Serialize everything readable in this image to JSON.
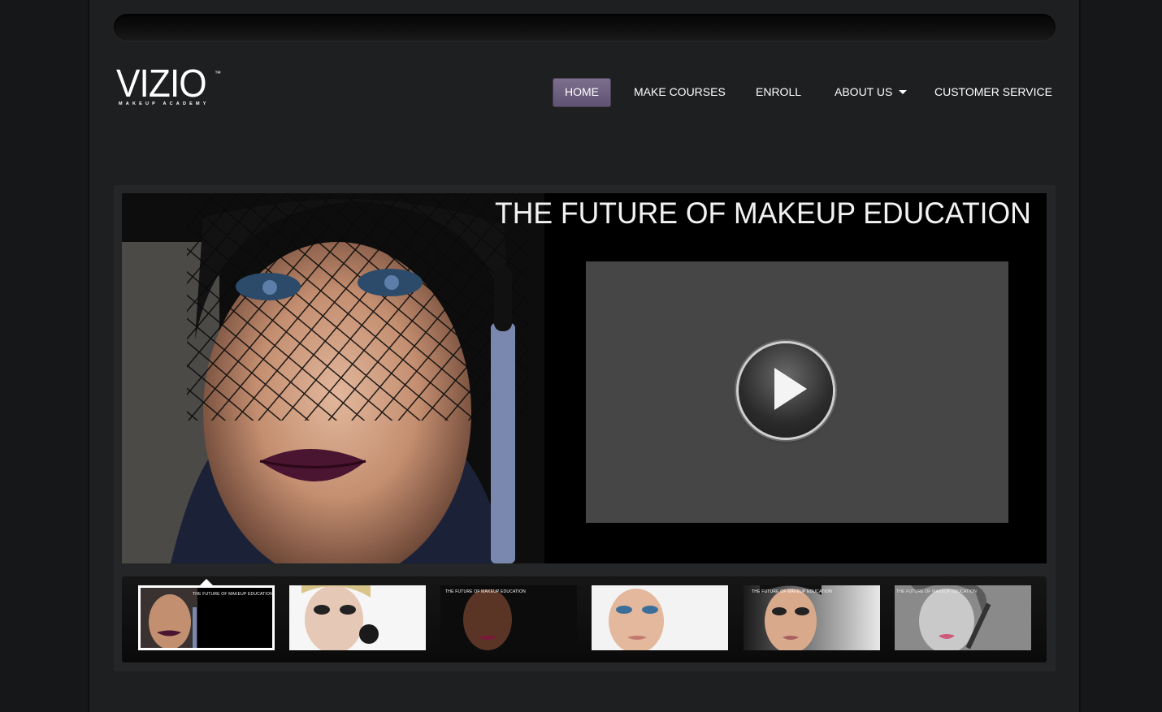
{
  "brand": {
    "name": "VIZIO",
    "tagline": "MAKEUP ACADEMY",
    "tm": "™"
  },
  "nav": {
    "items": [
      {
        "label": "HOME",
        "active": true
      },
      {
        "label": "MAKE COURSES",
        "active": false
      },
      {
        "label": "ENROLL",
        "active": false
      },
      {
        "label": "ABOUT US",
        "active": false,
        "has_dropdown": true
      },
      {
        "label": "CUSTOMER SERVICE",
        "active": false
      }
    ]
  },
  "hero": {
    "title": "THE FUTURE OF MAKEUP EDUCATION",
    "video": {
      "icon": "play-icon"
    }
  },
  "thumbnails": [
    {
      "caption": "THE FUTURE OF MAKEUP EDUCATION",
      "active": true
    },
    {
      "caption": "",
      "active": false
    },
    {
      "caption": "THE FUTURE OF MAKEUP EDUCATION",
      "active": false
    },
    {
      "caption": "",
      "active": false
    },
    {
      "caption": "THE FUTURE OF MAKEUP EDUCATION",
      "active": false
    },
    {
      "caption": "THE FUTURE OF MAKEUP EDUCATION",
      "active": false
    }
  ],
  "colors": {
    "nav_active": "#6f6180",
    "page_bg": "#1e1f20",
    "video_bg": "#464646"
  }
}
